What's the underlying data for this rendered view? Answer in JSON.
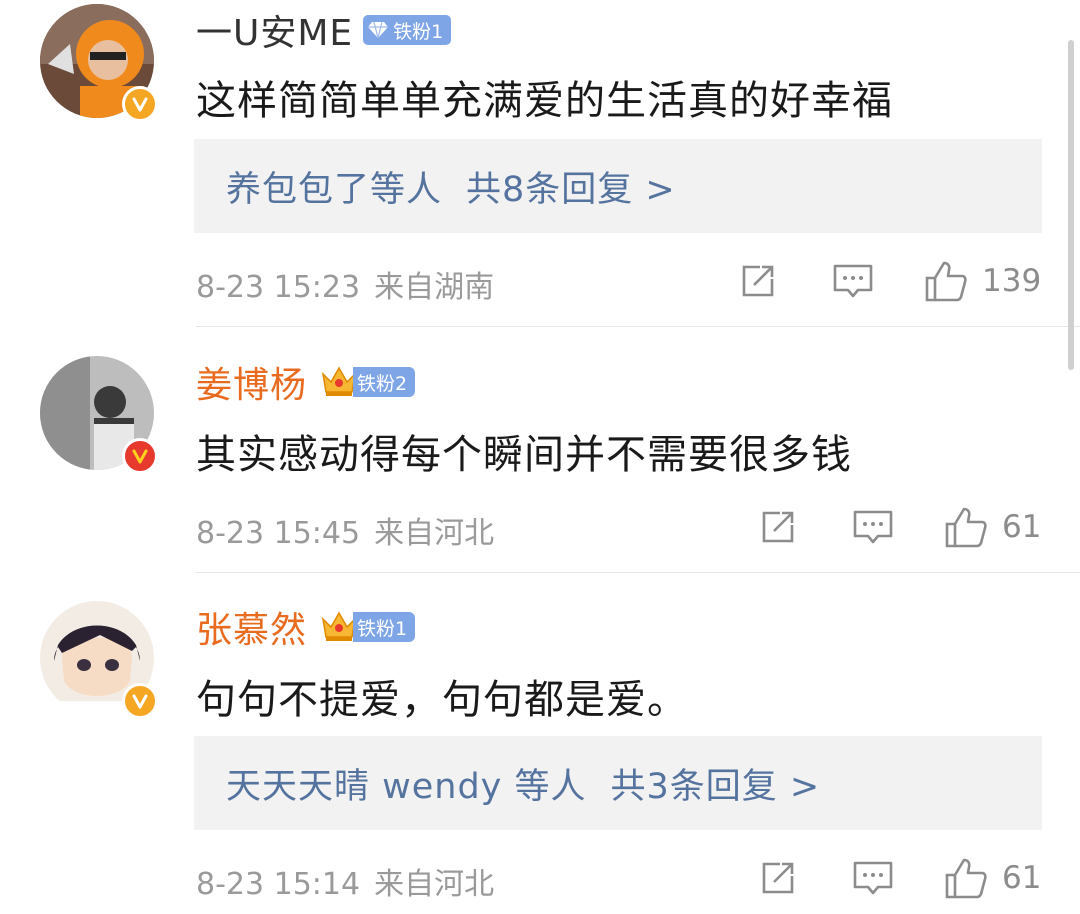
{
  "comments": [
    {
      "username": "一U安ME",
      "fan_badge": "铁粉1",
      "text": "这样简简单单充满爱的生活真的好幸福",
      "replies": {
        "who": "养包包了等人",
        "count_text": "共8条回复 >"
      },
      "time": "8-23 15:23",
      "location": "来自湖南",
      "likes": "139",
      "verified_color": "#f5a623"
    },
    {
      "username": "姜博杨",
      "fan_badge": "铁粉2",
      "text": "其实感动得每个瞬间并不需要很多钱",
      "time": "8-23 15:45",
      "location": "来自河北",
      "likes": "61",
      "verified_color": "#e8392e"
    },
    {
      "username": "张慕然",
      "fan_badge": "铁粉1",
      "text": "句句不提爱，句句都是爱。",
      "replies": {
        "who": "天天天晴 wendy 等人",
        "count_text": "共3条回复 >"
      },
      "time": "8-23 15:14",
      "location": "来自河北",
      "likes": "61",
      "verified_color": "#f5a623"
    }
  ],
  "icons": {
    "share": "share-icon",
    "comment": "comment-icon",
    "like": "thumbs-up-icon",
    "verified": "verified-v-icon",
    "crown": "crown-icon",
    "diamond": "diamond-icon"
  },
  "colors": {
    "link_blue": "#55739f",
    "vip_orange": "#e86b1f",
    "badge_blue": "#7ea6e6",
    "meta_gray": "#9a9a9a"
  }
}
